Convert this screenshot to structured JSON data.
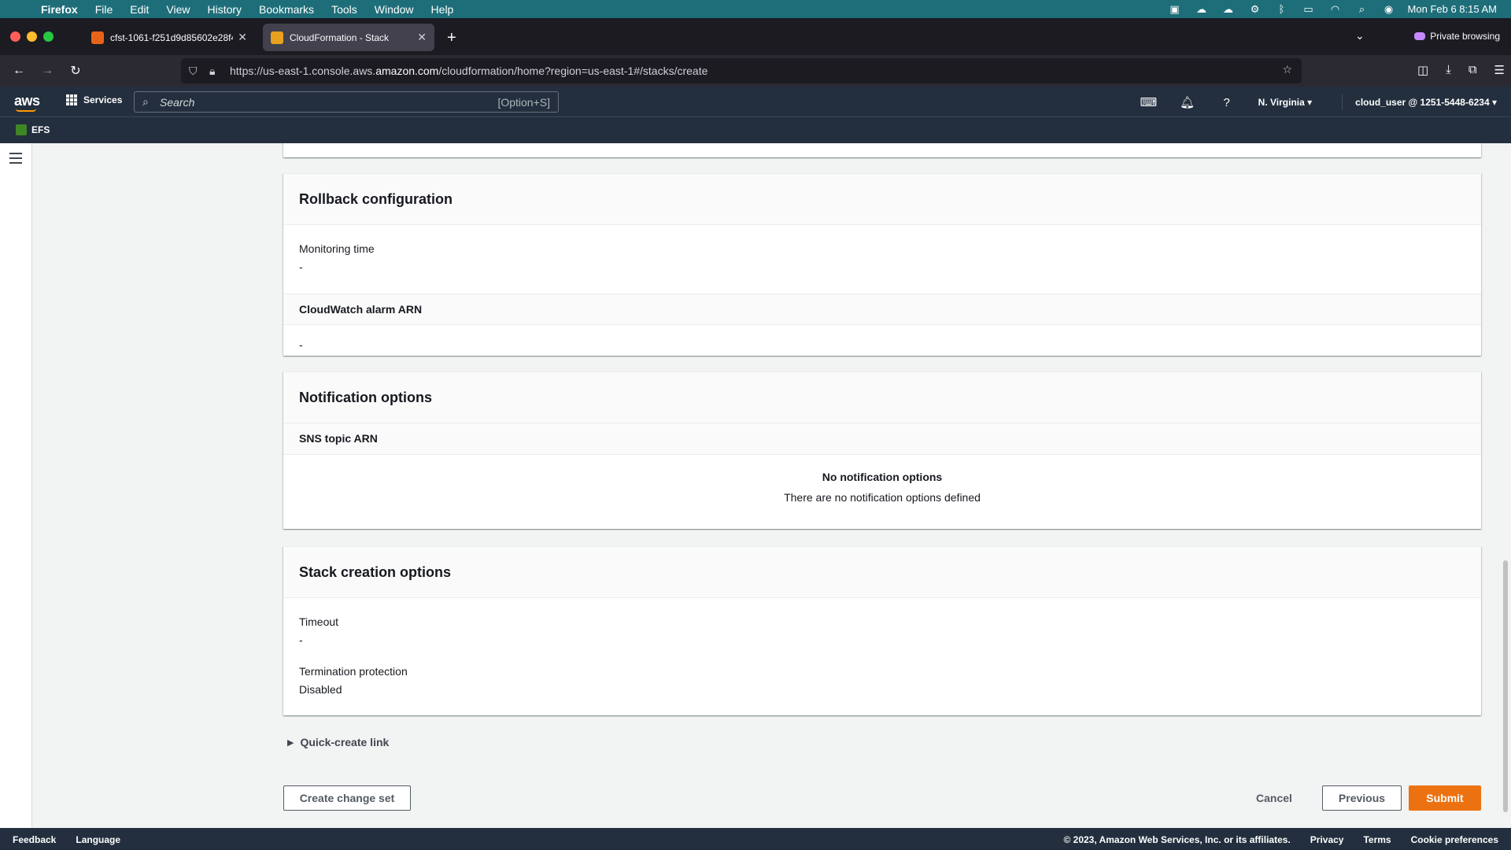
{
  "menubar": {
    "app": "Firefox",
    "items": [
      "File",
      "Edit",
      "View",
      "History",
      "Bookmarks",
      "Tools",
      "Window",
      "Help"
    ],
    "clock": "Mon Feb 6  8:15 AM"
  },
  "tabs": [
    {
      "title": "cfst-1061-f251d9d85602e28f4",
      "active": false
    },
    {
      "title": "CloudFormation - Stack",
      "active": true
    }
  ],
  "browser": {
    "private_label": "Private browsing",
    "url_prefix": "https://us-east-1.console.aws.",
    "url_domain": "amazon.com",
    "url_path": "/cloudformation/home?region=us-east-1#/stacks/create"
  },
  "aws": {
    "services": "Services",
    "search_placeholder": "Search",
    "search_shortcut": "[Option+S]",
    "region": "N. Virginia",
    "account": "cloud_user @ 1251-5448-6234",
    "favorite": "EFS"
  },
  "rollback": {
    "title": "Rollback configuration",
    "monitoring_label": "Monitoring time",
    "monitoring_value": "-",
    "alarm_header": "CloudWatch alarm ARN",
    "alarm_value": "-"
  },
  "notifications": {
    "title": "Notification options",
    "column": "SNS topic ARN",
    "empty_title": "No notification options",
    "empty_desc": "There are no notification options defined"
  },
  "stack_options": {
    "title": "Stack creation options",
    "timeout_label": "Timeout",
    "timeout_value": "-",
    "termination_label": "Termination protection",
    "termination_value": "Disabled"
  },
  "quick_create": "Quick-create link",
  "buttons": {
    "create_change_set": "Create change set",
    "cancel": "Cancel",
    "previous": "Previous",
    "submit": "Submit"
  },
  "footer": {
    "feedback": "Feedback",
    "language": "Language",
    "copyright": "© 2023, Amazon Web Services, Inc. or its affiliates.",
    "privacy": "Privacy",
    "terms": "Terms",
    "cookies": "Cookie preferences"
  },
  "colors": {
    "submit": "#ec7211",
    "aws_nav": "#232f3e",
    "menubar": "#1e6e7a"
  }
}
